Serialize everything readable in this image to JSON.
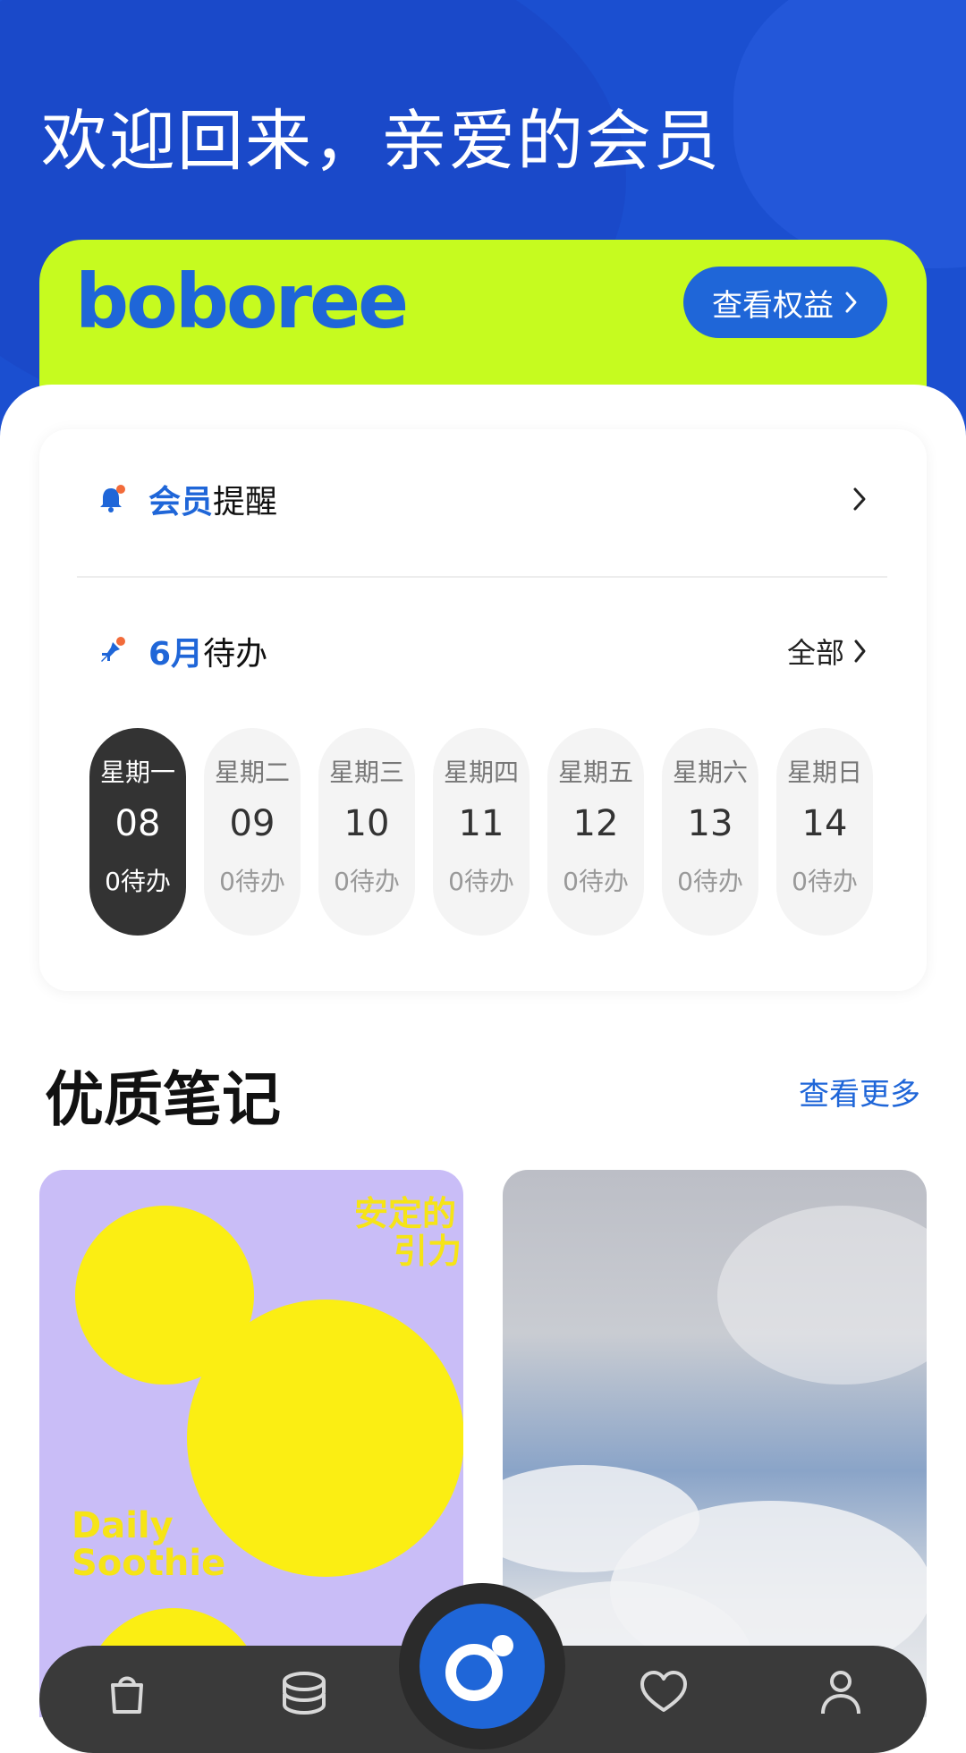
{
  "header": {
    "welcome": "欢迎回来，亲爱的会员"
  },
  "member_card": {
    "logo": "boboree",
    "benefit_button": "查看权益"
  },
  "reminder": {
    "label_highlight": "会员",
    "label_rest": "提醒",
    "icon": "bell-icon"
  },
  "todo": {
    "label_highlight": "6月",
    "label_rest": "待办",
    "all_link": "全部",
    "icon": "pin-icon",
    "days": [
      {
        "weekday": "星期一",
        "date": "08",
        "todo": "0待办",
        "active": true
      },
      {
        "weekday": "星期二",
        "date": "09",
        "todo": "0待办",
        "active": false
      },
      {
        "weekday": "星期三",
        "date": "10",
        "todo": "0待办",
        "active": false
      },
      {
        "weekday": "星期四",
        "date": "11",
        "todo": "0待办",
        "active": false
      },
      {
        "weekday": "星期五",
        "date": "12",
        "todo": "0待办",
        "active": false
      },
      {
        "weekday": "星期六",
        "date": "13",
        "todo": "0待办",
        "active": false
      },
      {
        "weekday": "星期日",
        "date": "14",
        "todo": "0待办",
        "active": false
      }
    ]
  },
  "notes": {
    "title": "优质笔记",
    "more_link": "查看更多",
    "items": [
      {
        "poster_title_line1": "安定的",
        "poster_title_line2": "引力",
        "poster_sub_line1": "Daily",
        "poster_sub_line2": "Soothie"
      },
      {}
    ]
  },
  "tabbar": {
    "tabs": [
      "shopping-bag-icon",
      "coins-icon",
      "community-icon",
      "heart-icon",
      "profile-icon"
    ]
  },
  "colors": {
    "brand_blue": "#1f66d8",
    "hero_blue": "#1b4fd0",
    "lime": "#c6fb1f",
    "dark": "#333333"
  }
}
